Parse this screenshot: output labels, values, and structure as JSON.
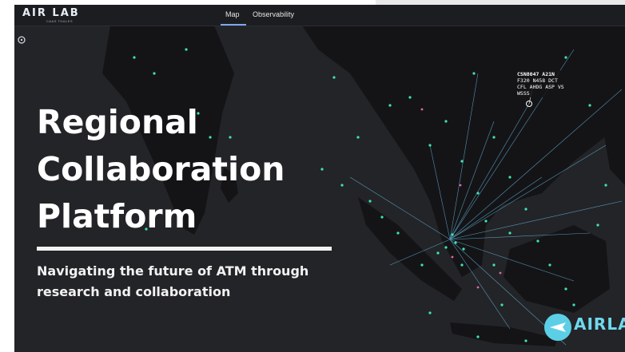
{
  "app": {
    "logo_text": "AIR LAB",
    "logo_subtext": "CAAS THALES"
  },
  "nav": {
    "tabs": [
      {
        "label": "Map",
        "active": true
      },
      {
        "label": "Observability",
        "active": false
      }
    ]
  },
  "hero": {
    "title_line1": "Regional",
    "title_line2": "Collaboration",
    "title_line3": "Platform",
    "subtitle_line1": "Navigating the future of ATM through",
    "subtitle_line2": "research and collaboration"
  },
  "flight_tooltip": {
    "line1": "CSN8047 A21N",
    "line2": "F320 N458 DCT",
    "line3": "CFL  AHDG ASP VS",
    "line4": "WSSS"
  },
  "brand_badge": {
    "text": "AIRLAB"
  },
  "colors": {
    "background": "#232428",
    "land": "#111114",
    "aircraft": "#3ee6b0",
    "routes": "#7fd6ff",
    "accent": "#7fa9f0"
  },
  "icons": {
    "side_icon": "compass-icon",
    "aircraft": "airplane-icon"
  }
}
